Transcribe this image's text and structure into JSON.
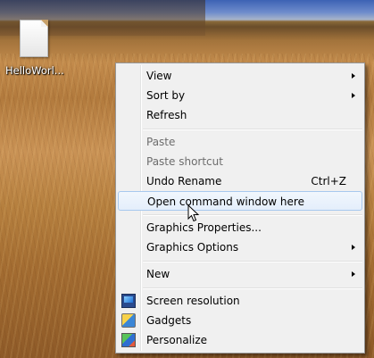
{
  "desktop": {
    "icon_label": "HelloWorl..."
  },
  "menu": {
    "items": [
      {
        "label": "View",
        "submenu": true
      },
      {
        "label": "Sort by",
        "submenu": true
      },
      {
        "label": "Refresh"
      },
      {
        "label": "Paste",
        "disabled": true
      },
      {
        "label": "Paste shortcut",
        "disabled": true
      },
      {
        "label": "Undo Rename",
        "shortcut": "Ctrl+Z"
      },
      {
        "label": "Open command window here",
        "highlighted": true
      },
      {
        "label": "Graphics Properties..."
      },
      {
        "label": "Graphics Options",
        "submenu": true
      },
      {
        "label": "New",
        "submenu": true
      },
      {
        "label": "Screen resolution",
        "icon": "screen-resolution-icon"
      },
      {
        "label": "Gadgets",
        "icon": "gadgets-icon"
      },
      {
        "label": "Personalize",
        "icon": "personalize-icon"
      }
    ]
  }
}
